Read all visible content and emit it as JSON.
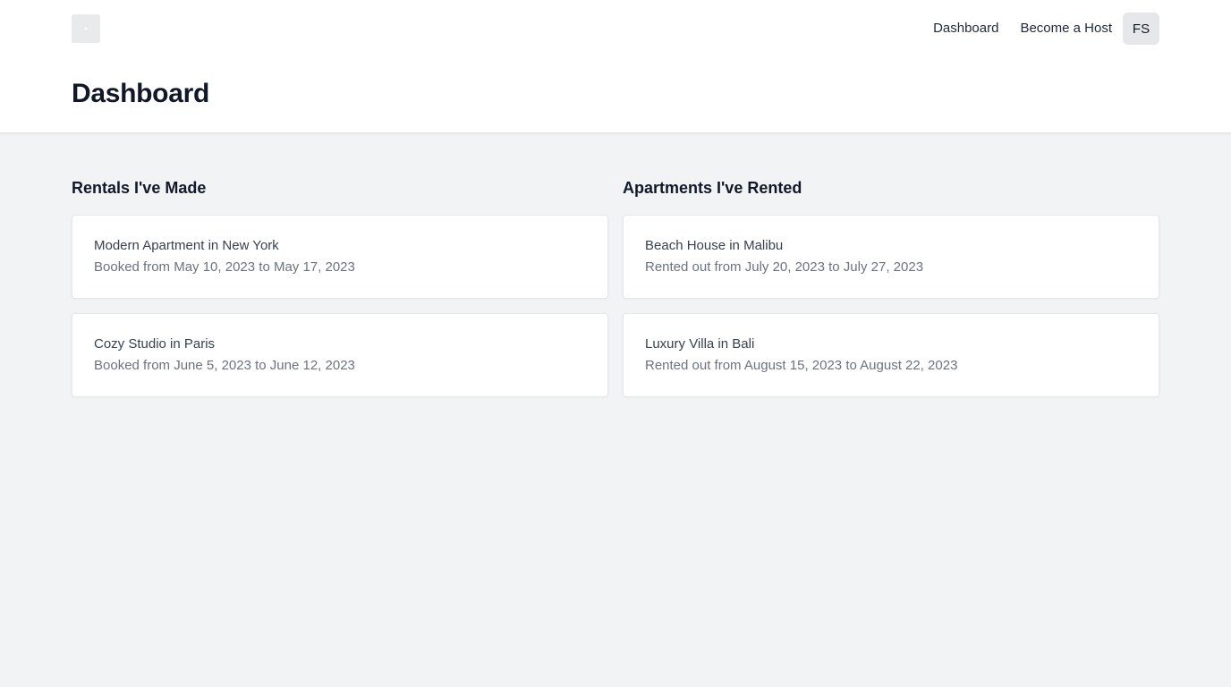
{
  "nav": {
    "logo_icon": "logo-icon",
    "links": [
      "Dashboard",
      "Become a Host"
    ],
    "avatar_initials": "FS"
  },
  "header": {
    "title": "Dashboard"
  },
  "rentals_made": {
    "title": "Rentals I've Made",
    "items": [
      {
        "name": "Modern Apartment in New York",
        "detail": "Booked from May 10, 2023 to May 17, 2023"
      },
      {
        "name": "Cozy Studio in Paris",
        "detail": "Booked from June 5, 2023 to June 12, 2023"
      }
    ]
  },
  "apartments_rented": {
    "title": "Apartments I've Rented",
    "items": [
      {
        "name": "Beach House in Malibu",
        "detail": "Rented out from July 20, 2023 to July 27, 2023"
      },
      {
        "name": "Luxury Villa in Bali",
        "detail": "Rented out from August 15, 2023 to August 22, 2023"
      }
    ]
  },
  "colors": {
    "page_background": "#f2f3f5",
    "card_background": "#ffffff",
    "avatar_background": "#e5e7eb",
    "muted_text": "#6b7280"
  }
}
